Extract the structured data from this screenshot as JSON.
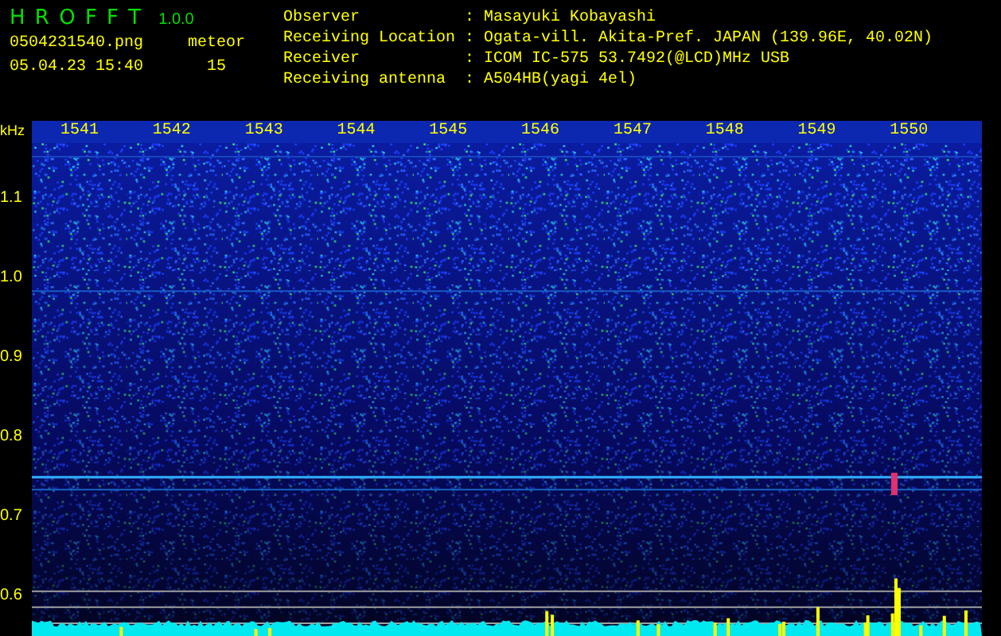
{
  "app": {
    "title": "H R O F F T",
    "version": "1.0.0"
  },
  "file": {
    "name": "0504231540.png",
    "datetime": "05.04.23 15:40"
  },
  "meteor": {
    "label": "meteor",
    "count": "15"
  },
  "info": [
    {
      "label": "Observer",
      "separator": ":",
      "value": "Masayuki Kobayashi"
    },
    {
      "label": "Receiving Location",
      "separator": ":",
      "value": "Ogata-vill. Akita-Pref. JAPAN (139.96E, 40.02N)"
    },
    {
      "label": "Receiver",
      "separator": ":",
      "value": "ICOM IC-575 53.7492(@LCD)MHz USB"
    },
    {
      "label": "Receiving antenna",
      "separator": ":",
      "value": "A504HB(yagi 4el)"
    }
  ],
  "axis": {
    "unit": "kHz",
    "y_labels": [
      "1.1",
      "1.0",
      "0.9",
      "0.8",
      "0.7",
      "0.6"
    ],
    "x_labels": [
      "1541",
      "1542",
      "1543",
      "1544",
      "1545",
      "1546",
      "1547",
      "1548",
      "1549",
      "1550"
    ]
  }
}
